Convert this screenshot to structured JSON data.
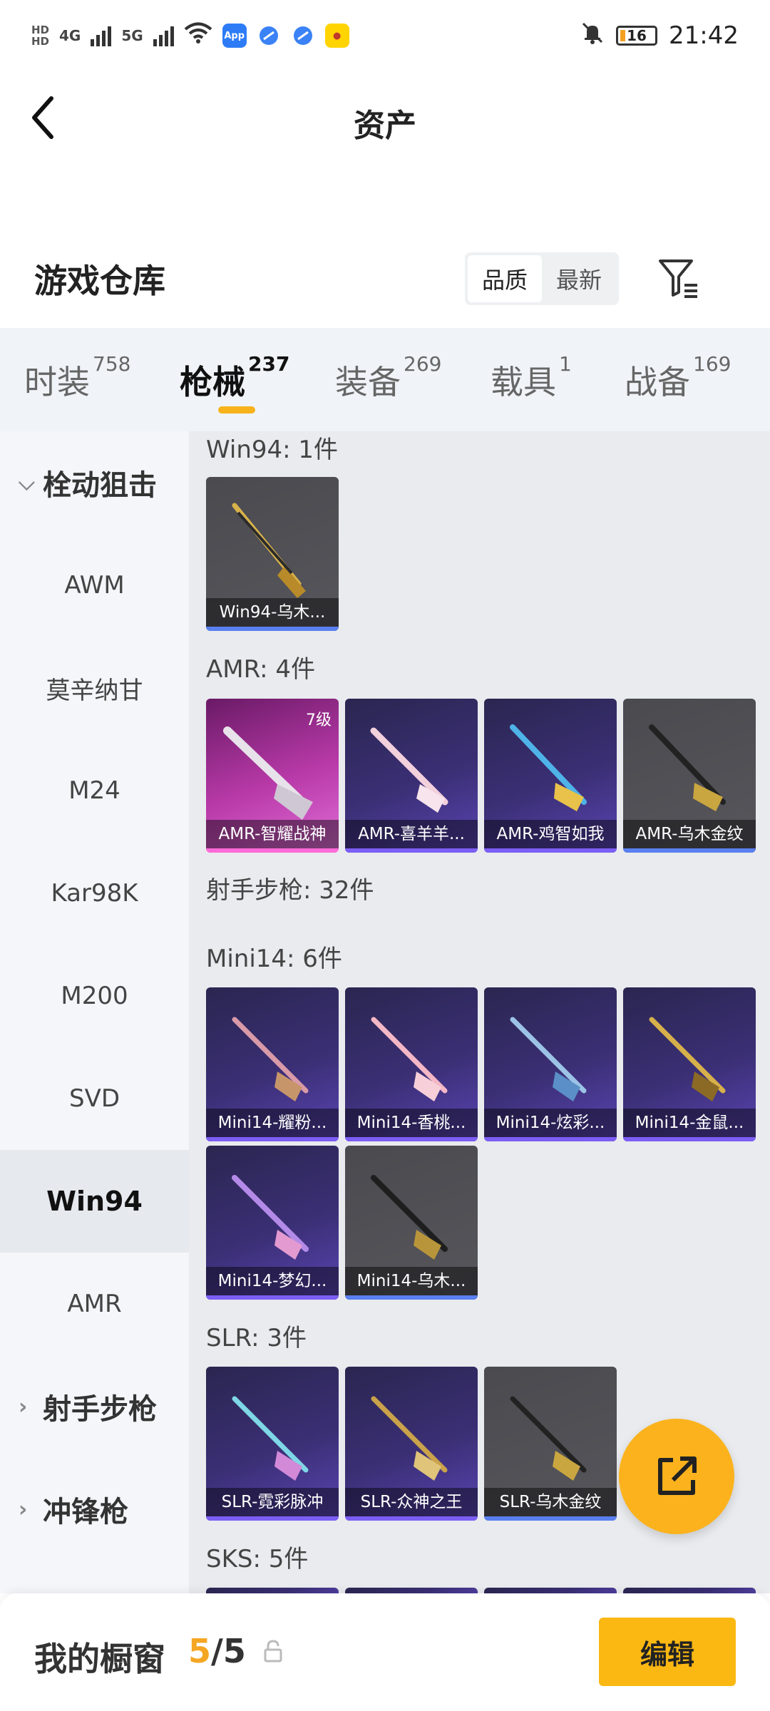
{
  "status_bar": {
    "hd1": "HD",
    "hd2": "HD",
    "net1": "4G",
    "net2": "5G",
    "battery": "16",
    "time": "21:42",
    "app_icons": [
      "app-store-icon",
      "browser-icon",
      "browser-icon-2",
      "game-app-icon"
    ]
  },
  "header": {
    "title": "资产"
  },
  "warehouse": {
    "title": "游戏仓库",
    "sort_quality": "品质",
    "sort_latest": "最新"
  },
  "categories": [
    {
      "label": "时装",
      "count": "758"
    },
    {
      "label": "枪械",
      "count": "237"
    },
    {
      "label": "装备",
      "count": "269"
    },
    {
      "label": "载具",
      "count": "1"
    },
    {
      "label": "战备",
      "count": "169"
    }
  ],
  "sidebar": {
    "group1": "栓动狙击",
    "items": [
      "AWM",
      "莫辛纳甘",
      "M24",
      "Kar98K",
      "M200",
      "SVD",
      "Win94",
      "AMR"
    ],
    "group2": "射手步枪",
    "group3": "冲锋枪"
  },
  "sections": {
    "win94": {
      "title": "Win94: 1件",
      "cards": [
        "Win94-乌木..."
      ]
    },
    "amr": {
      "title": "AMR: 4件",
      "level": "7级",
      "cards": [
        "AMR-智耀战神",
        "AMR-喜羊羊...",
        "AMR-鸡智如我",
        "AMR-乌木金纹"
      ]
    },
    "marksman": {
      "title": "射手步枪: 32件"
    },
    "mini14": {
      "title": "Mini14: 6件",
      "cards": [
        "Mini14-耀粉...",
        "Mini14-香桃...",
        "Mini14-炫彩...",
        "Mini14-金鼠...",
        "Mini14-梦幻...",
        "Mini14-乌木..."
      ]
    },
    "slr": {
      "title": "SLR: 3件",
      "cards": [
        "SLR-霓彩脉冲",
        "SLR-众神之王",
        "SLR-乌木金纹"
      ]
    },
    "sks": {
      "title": "SKS: 5件"
    }
  },
  "showcase": {
    "title": "我的橱窗",
    "used": "5",
    "separator": "/",
    "total": "5",
    "edit": "编辑"
  },
  "colors": {
    "accent": "#fbb21c",
    "active_text": "#111111"
  }
}
